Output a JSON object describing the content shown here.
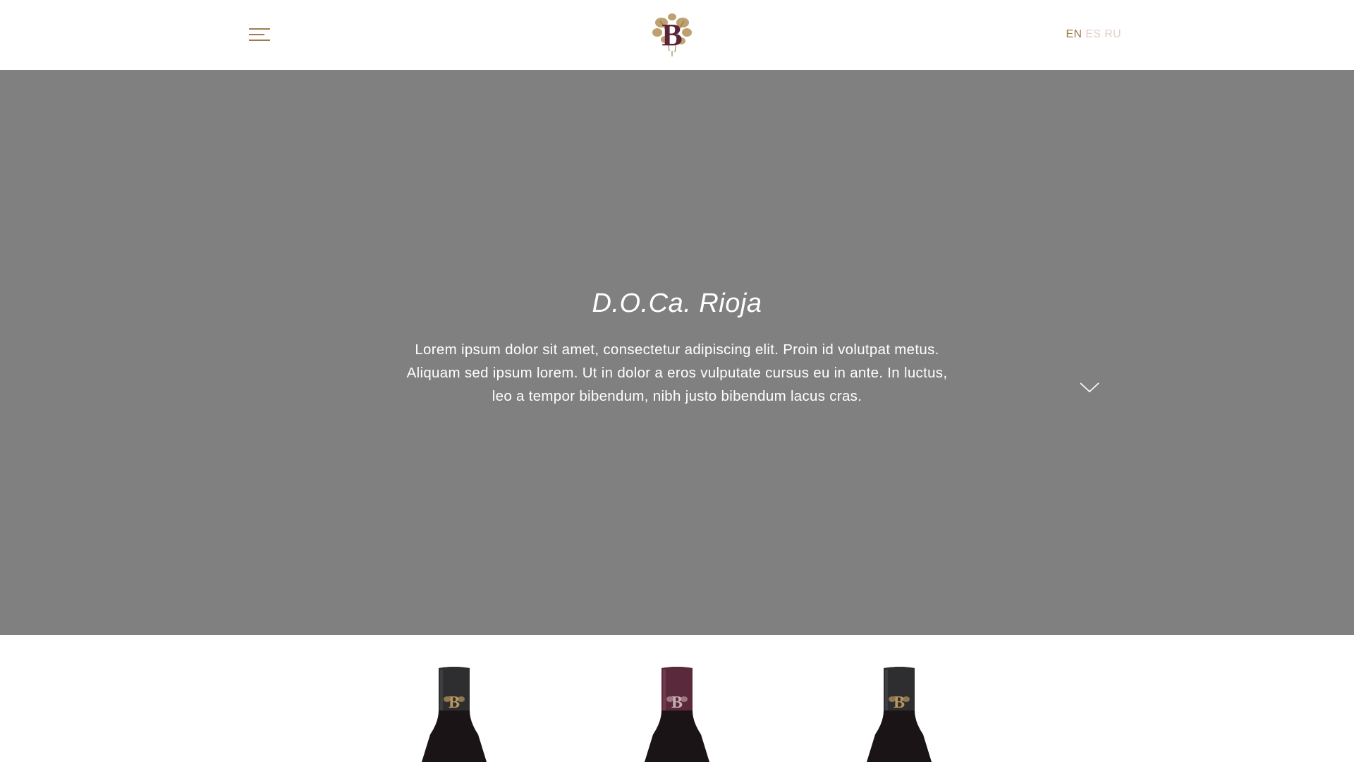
{
  "header": {
    "menu_icon": "hamburger-menu-icon",
    "logo_icon": "winery-monogram-logo",
    "languages": [
      {
        "code": "EN",
        "active": true
      },
      {
        "code": "ES",
        "active": false
      },
      {
        "code": "RU",
        "active": false
      }
    ]
  },
  "hero": {
    "title": "D.O.Ca. Rioja",
    "text": "Lorem ipsum dolor sit amet, consectetur adipiscing elit. Proin id volutpat metus. Aliquam sed ipsum lorem. Ut in dolor a eros vulputate cursus eu in ante. In luctus, leo a tempor bibendum, nibh justo bibendum lacus cras.",
    "scroll_icon": "chevron-down-icon",
    "background_color": "#808080"
  },
  "products": {
    "bottles": [
      {
        "capsule_color": "#2e2e30",
        "icon": "wine-bottle-black-capsule"
      },
      {
        "capsule_color": "#5a2a3c",
        "icon": "wine-bottle-burgundy-capsule"
      },
      {
        "capsule_color": "#2e2e30",
        "icon": "wine-bottle-black-capsule"
      }
    ]
  },
  "colors": {
    "accent_gold": "#a07a4e",
    "inactive_lang": "#e3cfc9",
    "logo_burgundy": "#5b2438"
  }
}
